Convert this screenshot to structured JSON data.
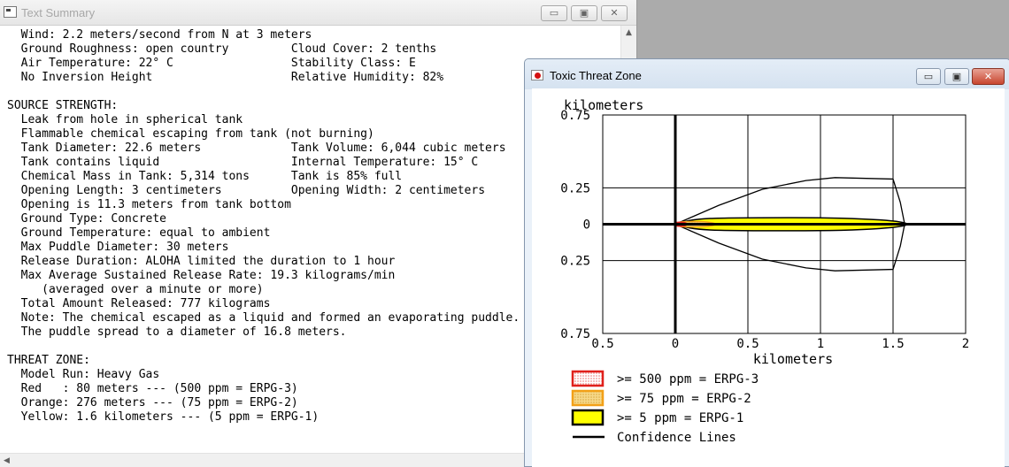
{
  "text_summary": {
    "title": "Text Summary",
    "controls": {
      "minimize": "▭",
      "maximize": "▣",
      "close": "✕"
    },
    "lines": [
      "  Wind: 2.2 meters/second from N at 3 meters",
      "  Ground Roughness: open country         Cloud Cover: 2 tenths",
      "  Air Temperature: 22° C                 Stability Class: E",
      "  No Inversion Height                    Relative Humidity: 82%",
      "",
      "SOURCE STRENGTH:",
      "  Leak from hole in spherical tank",
      "  Flammable chemical escaping from tank (not burning)",
      "  Tank Diameter: 22.6 meters             Tank Volume: 6,044 cubic meters",
      "  Tank contains liquid                   Internal Temperature: 15° C",
      "  Chemical Mass in Tank: 5,314 tons      Tank is 85% full",
      "  Opening Length: 3 centimeters          Opening Width: 2 centimeters",
      "  Opening is 11.3 meters from tank bottom",
      "  Ground Type: Concrete",
      "  Ground Temperature: equal to ambient",
      "  Max Puddle Diameter: 30 meters",
      "  Release Duration: ALOHA limited the duration to 1 hour",
      "  Max Average Sustained Release Rate: 19.3 kilograms/min",
      "     (averaged over a minute or more)",
      "  Total Amount Released: 777 kilograms",
      "  Note: The chemical escaped as a liquid and formed an evaporating puddle.",
      "  The puddle spread to a diameter of 16.8 meters.",
      "",
      "THREAT ZONE:",
      "  Model Run: Heavy Gas",
      "  Red   : 80 meters --- (500 ppm = ERPG-3)",
      "  Orange: 276 meters --- (75 ppm = ERPG-2)",
      "  Yellow: 1.6 kilometers --- (5 ppm = ERPG-1)"
    ]
  },
  "toxic_threat_zone": {
    "title": "Toxic Threat Zone",
    "controls": {
      "minimize": "▭",
      "maximize": "▣",
      "close": "✕"
    },
    "chart_data": {
      "type": "area",
      "title": "",
      "xlabel": "kilometers",
      "ylabel": "kilometers",
      "xlim": [
        -0.5,
        2
      ],
      "ylim": [
        -0.75,
        0.75
      ],
      "x_ticks": [
        -0.5,
        0,
        0.5,
        1,
        1.5,
        2
      ],
      "x_tick_labels": [
        "0.5",
        "0",
        "0.5",
        "1",
        "1.5",
        "2"
      ],
      "y_ticks": [
        0.75,
        0.25,
        0,
        -0.25,
        -0.75
      ],
      "y_tick_labels": [
        "0.75",
        "0.25",
        "0",
        "0.25",
        "0.75"
      ],
      "grid": true,
      "zones": [
        {
          "label": ">= 500 ppm = ERPG-3",
          "distance_km": 0.08,
          "half_width_km": 0.014,
          "fill": "#ffffff",
          "stroke": "#e0201b",
          "pattern": "dotted"
        },
        {
          "label": ">= 75 ppm = ERPG-2",
          "distance_km": 0.276,
          "half_width_km": 0.018,
          "fill": "#f4d27a",
          "stroke": "#f2a017",
          "pattern": "dotted"
        },
        {
          "label": ">= 5 ppm = ERPG-1",
          "distance_km": 1.6,
          "half_width_km": 0.045,
          "fill": "#ffff00",
          "stroke": "#000000",
          "pattern": "solid"
        }
      ],
      "confidence_lines": {
        "label": "Confidence Lines",
        "upper": [
          [
            0,
            0
          ],
          [
            0.3,
            0.13
          ],
          [
            0.6,
            0.24
          ],
          [
            0.9,
            0.3
          ],
          [
            1.1,
            0.32
          ],
          [
            1.5,
            0.31
          ]
        ],
        "end_cap": [
          [
            1.5,
            0.31
          ],
          [
            1.55,
            0.15
          ],
          [
            1.58,
            0
          ],
          [
            1.55,
            -0.15
          ],
          [
            1.5,
            -0.31
          ]
        ]
      }
    }
  }
}
